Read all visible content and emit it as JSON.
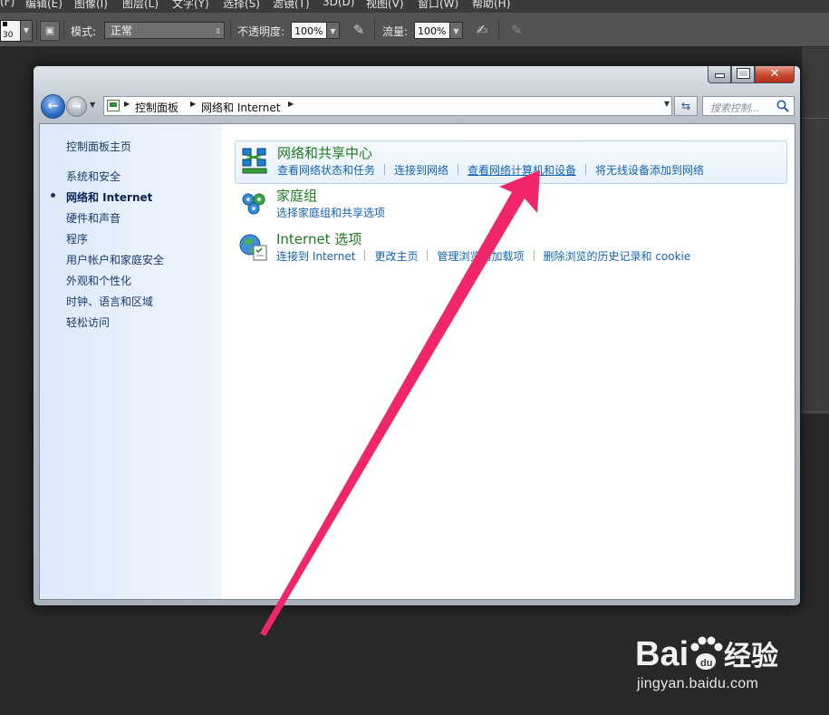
{
  "photoshop": {
    "menus": [
      "(F)",
      "编辑(E)",
      "图像(I)",
      "图层(L)",
      "文字(Y)",
      "选择(S)",
      "滤镜(T)",
      "3D(D)",
      "视图(V)",
      "窗口(W)",
      "帮助(H)"
    ],
    "brush_size": "30",
    "mode_label": "模式:",
    "mode_value": "正常",
    "opacity_label": "不透明度:",
    "opacity_value": "100%",
    "flow_label": "流量:",
    "flow_value": "100%"
  },
  "window": {
    "address": {
      "crumbs": [
        "控制面板",
        "网络和 Internet"
      ]
    },
    "search": {
      "placeholder": "搜索控制..."
    },
    "sidebar": {
      "home": "控制面板主页",
      "items": [
        {
          "label": "系统和安全",
          "current": false
        },
        {
          "label": "网络和 Internet",
          "current": true
        },
        {
          "label": "硬件和声音",
          "current": false
        },
        {
          "label": "程序",
          "current": false
        },
        {
          "label": "用户帐户和家庭安全",
          "current": false
        },
        {
          "label": "外观和个性化",
          "current": false
        },
        {
          "label": "时钟、语言和区域",
          "current": false
        },
        {
          "label": "轻松访问",
          "current": false
        }
      ]
    },
    "categories": [
      {
        "title": "网络和共享中心",
        "icon": "network-sharing-icon",
        "links": [
          "查看网络状态和任务",
          "连接到网络",
          "查看网络计算机和设备",
          "将无线设备添加到网络"
        ]
      },
      {
        "title": "家庭组",
        "icon": "homegroup-icon",
        "links": [
          "选择家庭组和共享选项"
        ]
      },
      {
        "title": "Internet 选项",
        "icon": "internet-options-icon",
        "links": [
          "连接到 Internet",
          "更改主页",
          "管理浏览器加载项",
          "删除浏览的历史记录和 cookie"
        ]
      }
    ]
  },
  "watermark": {
    "brand_left": "Bai",
    "brand_right": "经验",
    "url": "jingyan.baidu.com"
  },
  "colors": {
    "annotation_arrow": "#f0256a",
    "category_title": "#1e7a1e",
    "link": "#1464b4"
  }
}
